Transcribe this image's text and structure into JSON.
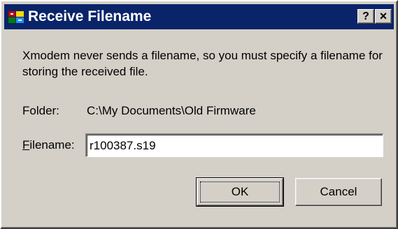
{
  "window": {
    "title": "Receive Filename",
    "app_icon": "terminal-app-icon",
    "help_icon": "?",
    "close_icon": "×",
    "titlebar_color": "#0a246a",
    "face_color": "#d4d0c8"
  },
  "message": "Xmodem never sends a filename, so you must specify a filename for storing the received file.",
  "folder": {
    "label": "Folder:",
    "value": "C:\\My Documents\\Old Firmware"
  },
  "filename": {
    "label_first": "F",
    "label_rest": "ilename:",
    "value": "r100387.s19"
  },
  "buttons": {
    "ok": "OK",
    "cancel": "Cancel"
  }
}
